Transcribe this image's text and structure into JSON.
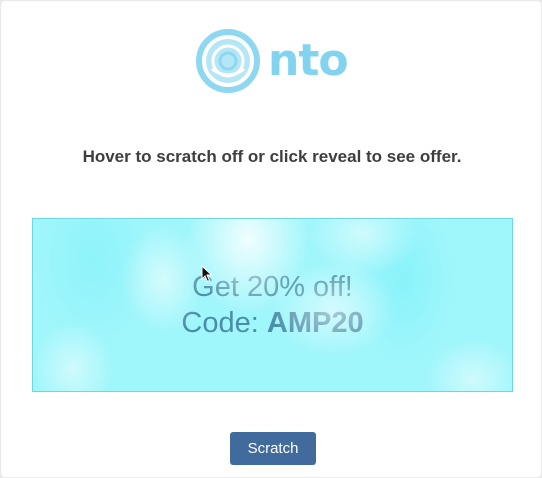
{
  "logo": {
    "text": "nto",
    "icon": "nto-logo-mark",
    "color": "#82d3ef"
  },
  "instruction": "Hover to scratch off or click reveal to see offer.",
  "offer": {
    "line1": "Get 20% off!",
    "code_label": "Code:",
    "code_value": "AMP20"
  },
  "scratch_card": {
    "color": "#9ff6fb"
  },
  "button": {
    "label": "Scratch",
    "color": "#426b9d"
  }
}
